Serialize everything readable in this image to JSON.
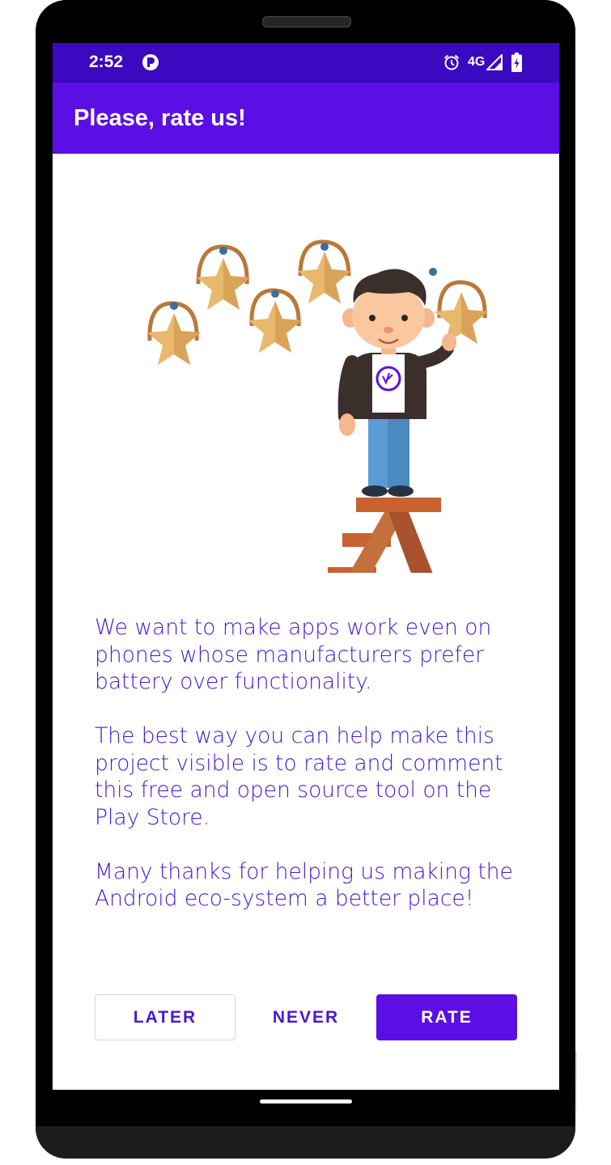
{
  "status_bar": {
    "time": "2:52",
    "network": "4G",
    "icons": [
      "app-notification-icon",
      "alarm-icon",
      "signal-icon",
      "battery-charging-icon"
    ]
  },
  "app_bar": {
    "title": "Please, rate us!"
  },
  "illustration": {
    "description_icon": "person-with-stars-illustration"
  },
  "message": {
    "paragraphs": [
      "We want to make apps work even on phones whose manufacturers prefer battery over functionality.",
      "The best way you can help make this project visible is to rate and comment this free and open source tool on the Play Store.",
      "Many thanks for helping us making the Android eco-system a better place!"
    ]
  },
  "buttons": {
    "later": "LATER",
    "never": "NEVER",
    "rate": "RATE"
  },
  "colors": {
    "status_bar": "#3a09c0",
    "app_bar": "#5b0fe4",
    "text": "#4518d2",
    "accent": "#5b0fe4"
  }
}
